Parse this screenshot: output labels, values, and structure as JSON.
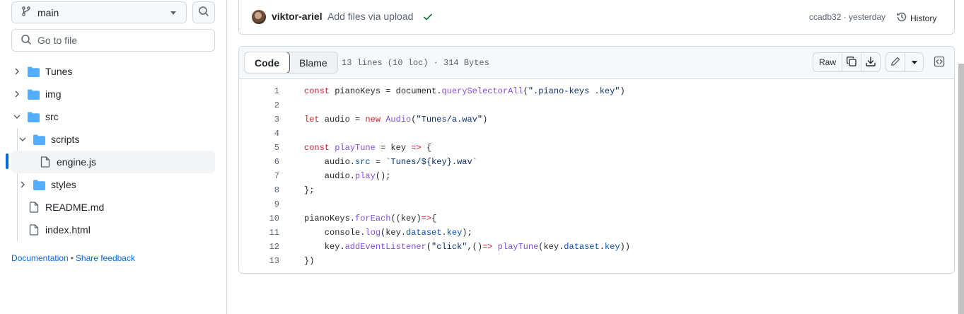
{
  "sidebar": {
    "branch": "main",
    "goto_placeholder": "Go to file",
    "tree": [
      {
        "label": "Tunes",
        "type": "folder",
        "expanded": false
      },
      {
        "label": "img",
        "type": "folder",
        "expanded": false
      },
      {
        "label": "src",
        "type": "folder",
        "expanded": true
      },
      {
        "label": "scripts",
        "type": "folder",
        "expanded": true
      },
      {
        "label": "engine.js",
        "type": "file",
        "selected": true
      },
      {
        "label": "styles",
        "type": "folder",
        "expanded": false
      },
      {
        "label": "README.md",
        "type": "file"
      },
      {
        "label": "index.html",
        "type": "file"
      }
    ],
    "footer": {
      "documentation": "Documentation",
      "separator": "•",
      "feedback": "Share feedback"
    }
  },
  "commit": {
    "author": "viktor-ariel",
    "message": "Add files via upload",
    "sha_time": "ccadb32 · yesterday",
    "history": "History"
  },
  "viewer": {
    "tabs": [
      "Code",
      "Blame"
    ],
    "file_info": "13 lines (10 loc) · 314 Bytes",
    "raw_label": "Raw"
  },
  "code": {
    "lines": [
      {
        "n": "1",
        "html": "<span class=\"k\">const</span> pianoKeys = document.<span class=\"f\">querySelectorAll</span>(<span class=\"s\">\".piano-keys .key\"</span>)"
      },
      {
        "n": "2",
        "html": ""
      },
      {
        "n": "3",
        "html": "<span class=\"k\">let</span> audio = <span class=\"k\">new</span> <span class=\"f\">Audio</span>(<span class=\"s\">\"Tunes/a.wav\"</span>)"
      },
      {
        "n": "4",
        "html": ""
      },
      {
        "n": "5",
        "html": "<span class=\"k\">const</span> <span class=\"f\">playTune</span> = key <span class=\"k\">=&gt;</span> {"
      },
      {
        "n": "6",
        "html": "    audio.<span class=\"p\">src</span> = <span class=\"s\">`Tunes/${key}.wav`</span>"
      },
      {
        "n": "7",
        "html": "    audio.<span class=\"f\">play</span>();"
      },
      {
        "n": "8",
        "html": "};"
      },
      {
        "n": "9",
        "html": ""
      },
      {
        "n": "10",
        "html": "pianoKeys.<span class=\"f\">forEach</span>((key)<span class=\"k\">=&gt;</span>{"
      },
      {
        "n": "11",
        "html": "    console.<span class=\"f\">log</span>(key.<span class=\"p\">dataset</span>.<span class=\"p\">key</span>);"
      },
      {
        "n": "12",
        "html": "    key.<span class=\"f\">addEventListener</span>(<span class=\"s\">\"click\"</span>,()<span class=\"k\">=&gt;</span> <span class=\"f\">playTune</span>(key.<span class=\"p\">dataset</span>.<span class=\"p\">key</span>))"
      },
      {
        "n": "13",
        "html": "})"
      }
    ]
  },
  "colors": {
    "accent": "#0969da",
    "success": "#1a7f37",
    "keyword": "#cf222e",
    "function": "#8250df",
    "string": "#0a3069",
    "property": "#0550ae"
  },
  "icons": [
    "git-branch-icon",
    "caret-down-icon",
    "search-icon",
    "chevron-right-icon",
    "chevron-down-icon",
    "folder-icon",
    "file-icon",
    "check-icon",
    "history-icon",
    "copy-icon",
    "download-icon",
    "pencil-icon",
    "symbols-icon"
  ]
}
